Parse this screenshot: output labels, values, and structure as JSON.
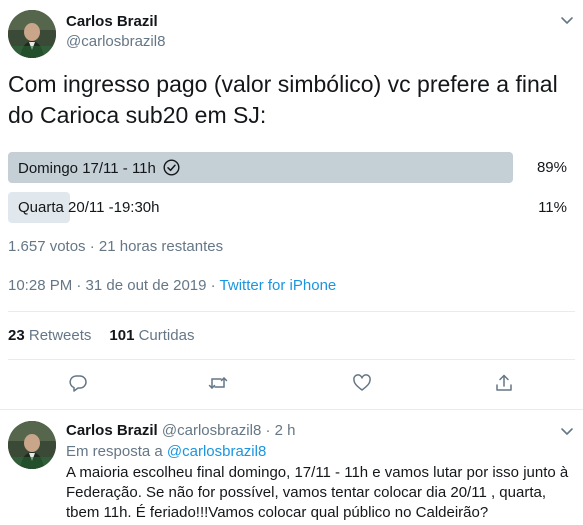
{
  "tweet": {
    "author_name": "Carlos Brazil",
    "author_handle": "@carlosbrazil8",
    "text": "Com ingresso pago (valor simbólico) vc prefere a final do Carioca sub20 em SJ:",
    "poll": {
      "options": [
        {
          "label": "Domingo 17/11 - 11h",
          "percent_text": "89%",
          "percent": 89,
          "winner": true
        },
        {
          "label": "Quarta 20/11 -19:30h",
          "percent_text": "11%",
          "percent": 11,
          "winner": false
        }
      ],
      "meta": "1.657 votos · 21 horas restantes"
    },
    "timestamp": "10:28 PM · 31 de out de 2019 · ",
    "source": "Twitter for iPhone",
    "stats": {
      "retweets_count": "23",
      "retweets_label": "Retweets",
      "likes_count": "101",
      "likes_label": "Curtidas"
    }
  },
  "reply": {
    "author_name": "Carlos Brazil",
    "author_handle": "@carlosbrazil8 · 2 h",
    "reply_to_prefix": "Em resposta a ",
    "reply_to_mention": "@carlosbrazil8",
    "text": "A maioria escolheu final domingo, 17/11 - 11h e vamos lutar por isso junto à Federação. Se não for possível, vamos tentar colocar dia 20/11 , quarta, tbem 11h. É feriado!!!Vamos colocar qual público no Caldeirão?"
  },
  "icons": {
    "reply": "comment-icon",
    "retweet": "retweet-icon",
    "like": "heart-icon",
    "share": "share-icon",
    "more": "chevron-down-icon",
    "check": "check-circle-icon"
  },
  "colors": {
    "link": "#1b95e0",
    "muted": "#657786",
    "poll_winner": "#c4cfd6",
    "poll_loser": "#e1e8ed"
  }
}
